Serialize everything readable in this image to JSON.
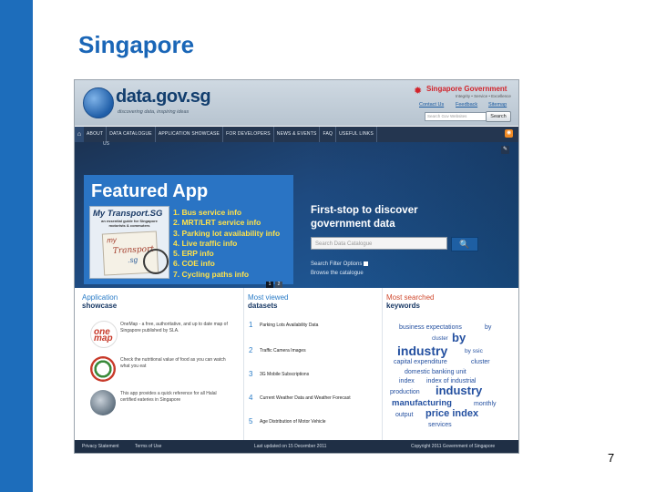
{
  "slide": {
    "title": "Singapore",
    "page_number": "7"
  },
  "site": {
    "logo": "data.gov.sg",
    "tagline": "discovering data, inspiring ideas",
    "gov_name": "Singapore Government",
    "gov_tagline": "Integrity • Service • Excellence",
    "links": [
      "Contact Us",
      "Feedback",
      "Sitemap"
    ],
    "search_placeholder": "Search Gov Websites",
    "search_button": "Search"
  },
  "nav": {
    "home_icon": "house-icon",
    "items": [
      "ABOUT",
      "DATA CATALOGUE",
      "APPLICATION SHOWCASE",
      "FOR DEVELOPERS",
      "NEWS & EVENTS",
      "FAQ",
      "USEFUL LINKS"
    ],
    "about_sub": "US",
    "rss_icon": "rss-icon"
  },
  "hero": {
    "featured_title": "Featured App",
    "card_title": "My Transport.SG",
    "card_subtitle": "an essential guide for Singapore motorists & commuters",
    "card_logo_1": "my",
    "card_logo_2": "Transport",
    "card_logo_3": ".sg",
    "features": [
      "1. Bus service info",
      "2. MRT/LRT service info",
      "3. Parking lot availability info",
      "4. Live traffic info",
      "5. ERP info",
      "6. COE info",
      "7. Cycling paths info"
    ],
    "cta_line1": "First-stop to discover",
    "cta_line2": "government data",
    "search_placeholder": "Search Data Catalogue",
    "search_icon": "magnifier-icon",
    "search_options": "Search Filter Options",
    "browse": "Browse the catalogue",
    "pager": [
      "1",
      "2"
    ]
  },
  "app_showcase": {
    "h1": "Application",
    "h2": "showcase",
    "apps": [
      {
        "desc": "OneMap - a free, authoritative, and up to date map of Singapore published by SLA.",
        "color": "#c83a2a",
        "icon": "onemap-icon"
      },
      {
        "desc": "Check the nutritional value of food as you can watch what you eat",
        "color": "#3a8a3a",
        "icon": "nutrition-icon"
      },
      {
        "desc": "This app provides a quick reference for all Halal certified eateries in Singapore",
        "color": "#5a6b7a",
        "icon": "halal-icon"
      }
    ]
  },
  "most_viewed": {
    "h1": "Most viewed",
    "h2": "datasets",
    "items": [
      {
        "n": "1",
        "t": "Parking Lots Availability Data"
      },
      {
        "n": "2",
        "t": "Traffic Camera Images"
      },
      {
        "n": "3",
        "t": "3G Mobile Subscriptions"
      },
      {
        "n": "4",
        "t": "Current Weather Data and Weather Forecast"
      },
      {
        "n": "5",
        "t": "Age Distribution of Motor Vehicle"
      }
    ]
  },
  "most_searched": {
    "h1": "Most searched",
    "h2": "keywords",
    "keywords": [
      "business expectations",
      "by",
      "cluster",
      "by",
      "industry",
      "by ssic",
      "capital expenditure",
      "cluster",
      "domestic banking unit",
      "index",
      "index of industrial",
      "production",
      "industry",
      "manufacturing",
      "monthly",
      "output",
      "price index",
      "services"
    ]
  },
  "footer": {
    "privacy": "Privacy Statement",
    "terms": "Terms of Use",
    "updated": "Last updated on 15 December 2011",
    "copyright": "Copyright 2011 Government of Singapore"
  },
  "colors": {
    "slide_blue": "#1d6dbb",
    "nav_bg": "#243650",
    "accent_yellow": "#ffe24a",
    "link_blue": "#2a7cc7",
    "keyword_blue": "#2450a0",
    "gov_red": "#d2232a"
  }
}
